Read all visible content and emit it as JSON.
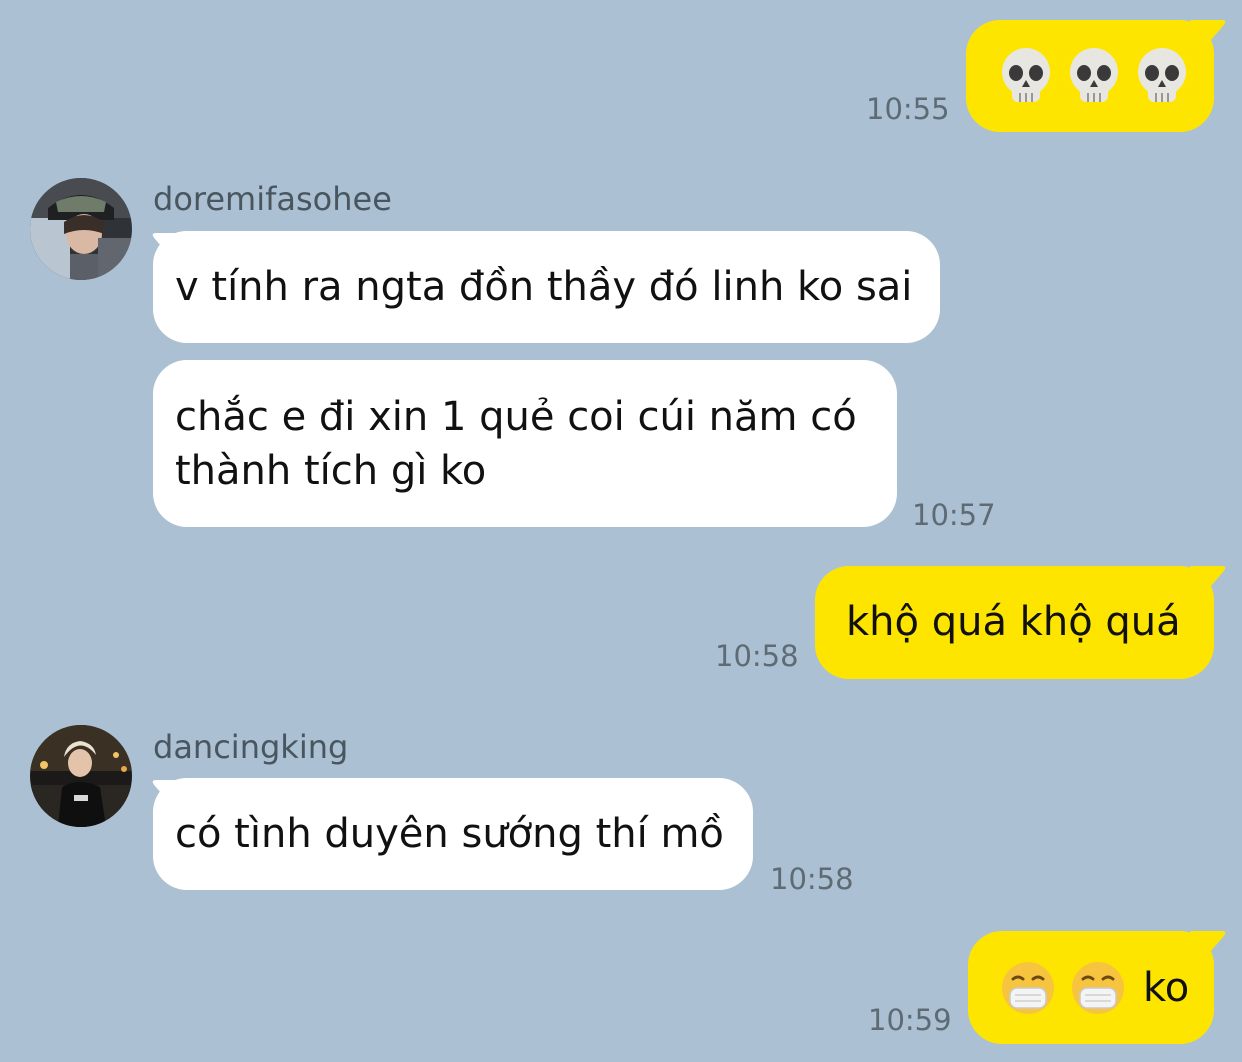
{
  "messages": [
    {
      "direction": "outgoing",
      "content": [
        "skull-emoji",
        "skull-emoji",
        "skull-emoji"
      ],
      "time": "10:55"
    },
    {
      "direction": "incoming",
      "sender": "doremifasohee",
      "text": "v tính ra ngta đồn thầy đó linh ko sai"
    },
    {
      "direction": "incoming",
      "text": "chắc e đi xin 1 quẻ coi cúi năm có\nthành tích gì ko",
      "time": "10:57"
    },
    {
      "direction": "outgoing",
      "text": "khộ quá khộ quá",
      "time": "10:58"
    },
    {
      "direction": "incoming",
      "sender": "dancingking",
      "text": "có tình duyên sướng thí mồ",
      "time": "10:58"
    },
    {
      "direction": "outgoing",
      "content": [
        "mask-face-emoji",
        "mask-face-emoji"
      ],
      "text": "ko",
      "time": "10:59"
    }
  ],
  "colors": {
    "background": "#abc1d3",
    "incoming_bubble": "#ffffff",
    "outgoing_bubble": "#fee500",
    "timestamp": "#5f6b74",
    "sender_name": "#495660"
  }
}
